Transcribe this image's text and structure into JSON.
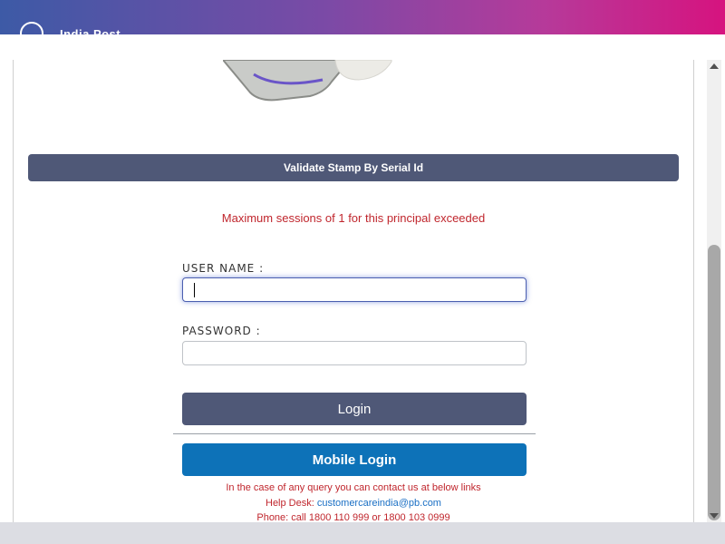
{
  "header": {
    "logo_text": "India Post",
    "gradient_colors": [
      "#3d5aa6",
      "#d6137f"
    ]
  },
  "validate": {
    "label": "Validate Stamp By Serial Id"
  },
  "error": {
    "message": "Maximum sessions of 1 for this principal exceeded"
  },
  "form": {
    "username_label": "USER NAME :",
    "username_value": "",
    "password_label": "PASSWORD :",
    "password_value": "",
    "login_label": "Login",
    "mobile_login_label": "Mobile Login"
  },
  "help": {
    "line1": "In the case of any query you can contact us at below links",
    "helpdesk_prefix": "Help Desk: ",
    "helpdesk_email": "customercareindia@pb.com",
    "phone": "Phone: call 1800 110 999 or 1800 103 0999"
  },
  "colors": {
    "primary_button": "#4f5877",
    "mobile_button": "#0d72b8",
    "error_text": "#c0262d"
  }
}
